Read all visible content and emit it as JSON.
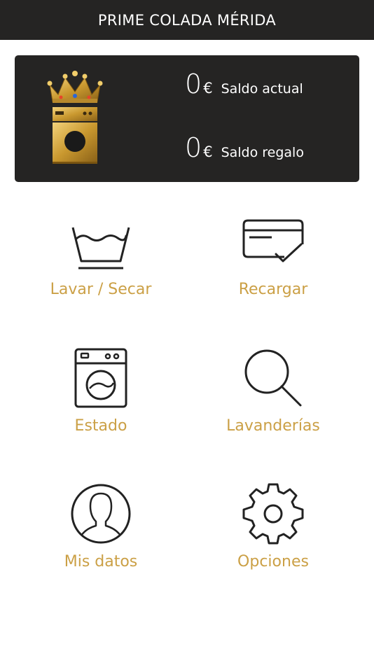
{
  "header": {
    "title": "PRIME COLADA MÉRIDA"
  },
  "balance": {
    "current": {
      "amount": "0",
      "currency": "€",
      "label": "Saldo actual"
    },
    "gift": {
      "amount": "0",
      "currency": "€",
      "label": "Saldo regalo"
    }
  },
  "menu": {
    "wash_dry": "Lavar / Secar",
    "recharge": "Recargar",
    "status": "Estado",
    "laundries": "Lavanderías",
    "my_data": "Mis datos",
    "options": "Opciones"
  },
  "colors": {
    "header_bg": "#252423",
    "accent_gold": "#cba046",
    "icon_stroke": "#222222"
  },
  "icons": {
    "logo": "crown-washing-machine-logo",
    "wash_dry": "wash-basin-icon",
    "recharge": "credit-card-check-icon",
    "status": "washing-machine-icon",
    "laundries": "search-icon",
    "my_data": "user-profile-icon",
    "options": "gear-icon"
  }
}
